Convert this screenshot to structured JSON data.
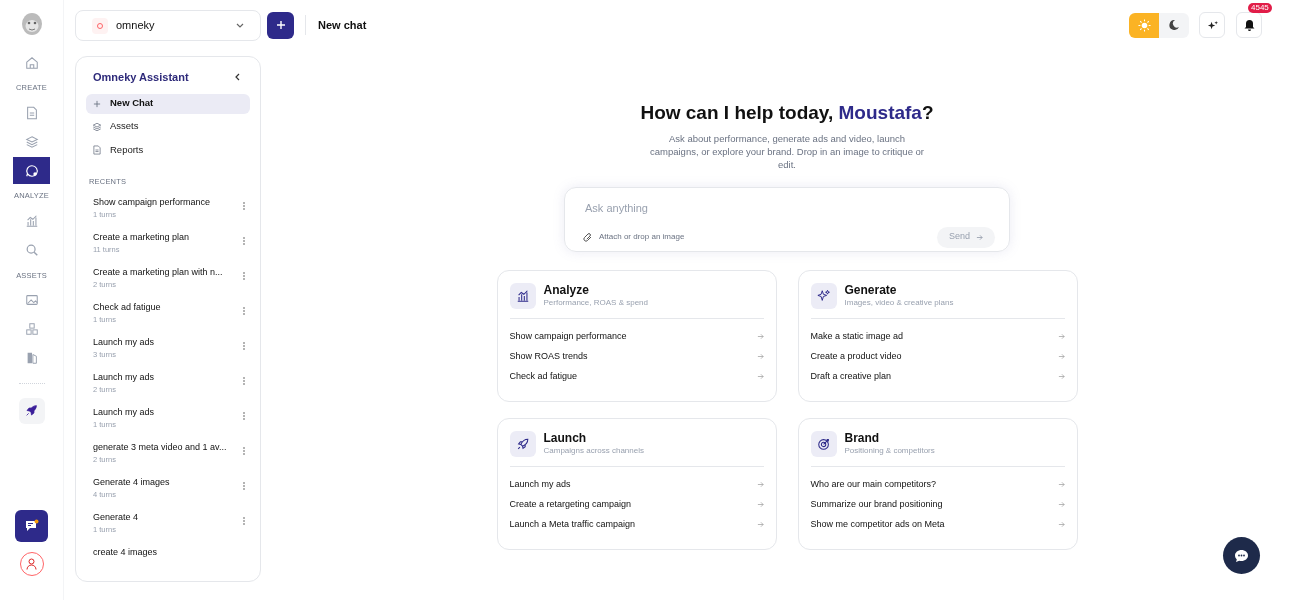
{
  "rail": {
    "items": [
      {
        "kind": "icon",
        "selected": false
      },
      {
        "kind": "label",
        "text": "CREATE"
      },
      {
        "kind": "icon",
        "selected": false
      },
      {
        "kind": "icon",
        "selected": false
      },
      {
        "kind": "icon",
        "selected": true
      },
      {
        "kind": "label",
        "text": "ANALYZE"
      },
      {
        "kind": "icon",
        "selected": false
      },
      {
        "kind": "icon",
        "selected": false
      },
      {
        "kind": "label",
        "text": "ASSETS"
      },
      {
        "kind": "icon",
        "selected": false
      },
      {
        "kind": "icon",
        "selected": false
      },
      {
        "kind": "icon",
        "selected": false
      }
    ]
  },
  "workspace": {
    "name": "omneky"
  },
  "header": {
    "title": "New chat",
    "notifications": "4545",
    "theme_toggle": [
      {
        "selected": true
      },
      {
        "selected": false
      }
    ]
  },
  "assistant": {
    "title": "Omneky Assistant",
    "nav": [
      {
        "label": "New Chat",
        "selected": true
      },
      {
        "label": "Assets",
        "selected": false
      },
      {
        "label": "Reports",
        "selected": false
      }
    ],
    "recents_label": "RECENTS",
    "recents": [
      {
        "title": "Show campaign performance",
        "turns": "1 turns"
      },
      {
        "title": "Create a marketing plan",
        "turns": "11 turns"
      },
      {
        "title": "Create a marketing plan with n...",
        "turns": "2 turns"
      },
      {
        "title": "Check ad fatigue",
        "turns": "1 turns"
      },
      {
        "title": "Launch my ads",
        "turns": "3 turns"
      },
      {
        "title": "Launch my ads",
        "turns": "2 turns"
      },
      {
        "title": "Launch my ads",
        "turns": "1 turns"
      },
      {
        "title": "generate 3 meta video and 1 av...",
        "turns": "2 turns"
      },
      {
        "title": "Generate 4 images",
        "turns": "4 turns"
      },
      {
        "title": "Generate 4",
        "turns": "1 turns"
      },
      {
        "title": "create 4 images"
      }
    ]
  },
  "hero": {
    "heading": "How can I help today, ",
    "name": "Moustafa",
    "heading_end": "?",
    "subtitle": "Ask about performance, generate ads and video, launch campaigns, or explore your brand. Drop in an image to critique or edit."
  },
  "composer": {
    "placeholder": "Ask anything",
    "attach": "Attach or drop an image",
    "send": "Send",
    "send_disabled": true
  },
  "cards": [
    {
      "title": "Analyze",
      "subtitle": "Performance, ROAS & spend",
      "prompts": [
        "Show campaign performance",
        "Show ROAS trends",
        "Check ad fatigue"
      ]
    },
    {
      "title": "Generate",
      "subtitle": "Images, video & creative plans",
      "prompts": [
        "Make a static image ad",
        "Create a product video",
        "Draft a creative plan"
      ]
    },
    {
      "title": "Launch",
      "subtitle": "Campaigns across channels",
      "prompts": [
        "Launch my ads",
        "Create a retargeting campaign",
        "Launch a Meta traffic campaign"
      ]
    },
    {
      "title": "Brand",
      "subtitle": "Positioning & competitors",
      "prompts": [
        "Who are our main competitors?",
        "Summarize our brand positioning",
        "Show me competitor ads on Meta"
      ]
    }
  ]
}
